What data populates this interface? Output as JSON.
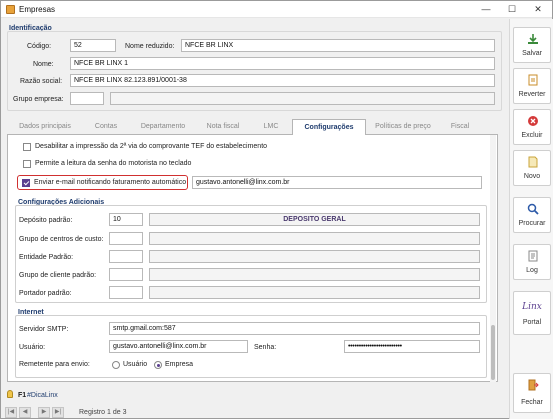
{
  "window": {
    "title": "Empresas",
    "minimize": "—",
    "maximize": "☐",
    "close": "✕"
  },
  "identificacao": {
    "group_title": "Identificação",
    "codigo_label": "Código:",
    "codigo_value": "52",
    "nome_reduzido_label": "Nome reduzido:",
    "nome_reduzido_value": "NFCE BR LINX",
    "nome_label": "Nome:",
    "nome_value": "NFCE BR LINX 1",
    "razao_label": "Razão social:",
    "razao_value": "NFCE BR LINX 82.123.891/0001-38",
    "grupo_label": "Grupo empresa:",
    "grupo_value": ""
  },
  "tabs": [
    {
      "label": "Dados principais"
    },
    {
      "label": "Contas"
    },
    {
      "label": "Departamento"
    },
    {
      "label": "Nota fiscal"
    },
    {
      "label": "LMC"
    },
    {
      "label": "Configurações"
    },
    {
      "label": "Políticas de preço"
    },
    {
      "label": "Fiscal"
    }
  ],
  "active_tab": "Configurações",
  "config": {
    "opt_tef": {
      "label": "Desabilitar a impressão da 2ª via do comprovante TEF do estabelecimento",
      "checked": false
    },
    "opt_senha": {
      "label": "Permite a leitura da senha do motorista no teclado",
      "checked": false
    },
    "opt_email": {
      "label": "Enviar e-mail notificando faturamento automático",
      "checked": true,
      "value": "gustavo.antonelli@linx.com.br"
    }
  },
  "adicionais": {
    "title": "Configurações Adicionais",
    "deposito_label": "Depósito padrão:",
    "deposito_code": "10",
    "deposito_name": "DEPOSITO GERAL",
    "grupo_cc_label": "Grupo de centros de custo:",
    "entidade_label": "Entidade Padrão:",
    "grupo_cliente_label": "Grupo de cliente padrão:",
    "portador_label": "Portador padrão:"
  },
  "internet": {
    "title": "Internet",
    "smtp_label": "Servidor SMTP:",
    "smtp_value": "smtp.gmail.com:587",
    "usuario_label": "Usuário:",
    "usuario_value": "gustavo.antonelli@linx.com.br",
    "senha_label": "Senha:",
    "senha_value": "•••••••••••••••••••••••••",
    "remetente_label": "Remetente para envio:",
    "radio_usuario": "Usuário",
    "radio_empresa": "Empresa",
    "selected": "Empresa"
  },
  "status": {
    "tip": "#DicaLinx",
    "tip_key": "F1",
    "record": "Registro 1 de 3"
  },
  "sidebar": {
    "salvar": "Salvar",
    "reverter": "Reverter",
    "excluir": "Excluir",
    "novo": "Novo",
    "procurar": "Procurar",
    "log": "Log",
    "portal": "Portal",
    "portal_brand": "Linx",
    "fechar": "Fechar"
  },
  "colors": {
    "accent": "#5b3f8f",
    "highlight": "#d03030",
    "group_title": "#1f3c6e"
  }
}
